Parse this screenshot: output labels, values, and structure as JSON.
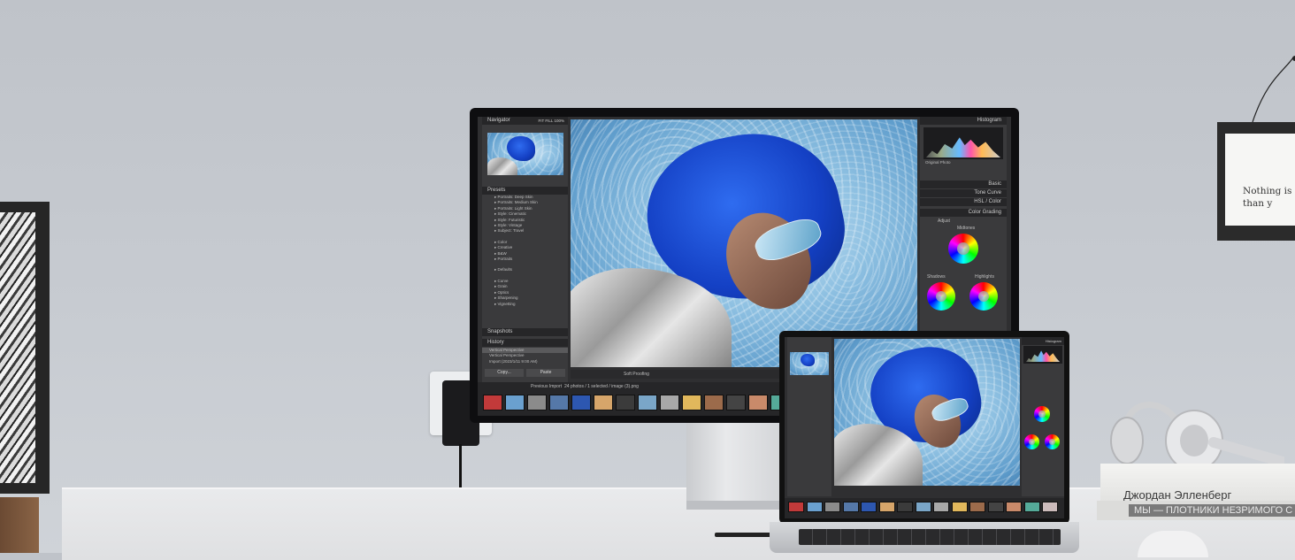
{
  "scene": {
    "description_free": true
  },
  "wall_frame": {
    "text": "Nothing is m\nthan y"
  },
  "book": {
    "author": "Джордан Элленберг",
    "title": "МЫ — ПЛОТНИКИ НЕЗРИМОГО С"
  },
  "monitor": {
    "left_panel": {
      "navigator": "Navigator",
      "navigator_zoom": "FIT  FILL  100%",
      "presets": "Presets",
      "preset_items": [
        "Portraits: Deep Skin",
        "Portraits: Medium Skin",
        "Portraits: Light Skin",
        "Style: Cinematic",
        "Style: Futuristic",
        "Style: Vintage",
        "Subject: Travel"
      ],
      "preset_items_2": [
        "Color",
        "Creative",
        "B&W",
        "Portraits"
      ],
      "preset_items_3": [
        "Defaults"
      ],
      "preset_items_4": [
        "Curve",
        "Grain",
        "Optics",
        "Sharpening",
        "Vignetting"
      ],
      "snapshots": "Snapshots",
      "history": "History",
      "history_items": [
        "Vertical Perspective",
        "Vertical Perspective",
        "Import (2023/1/11 9:00 AM)"
      ],
      "copy": "Copy...",
      "paste": "Paste"
    },
    "toolbar": {
      "soft_proofing": "Soft Proofing"
    },
    "filmstrip": {
      "source": "Previous Import",
      "info": "24 photos / 1 selected / image (3).png"
    },
    "right_panel": {
      "histogram": "Histogram",
      "original_photo": "Original Photo",
      "basic": "Basic",
      "tone_curve": "Tone Curve",
      "hsl": "HSL / Color",
      "color_grading": "Color Grading",
      "adjust": "Adjust",
      "midtones": "Midtones",
      "shadows": "Shadows",
      "highlights": "Highlights"
    }
  },
  "laptop": {
    "top_right": "Histogram"
  },
  "colors": {
    "wall": "#c3c7cd",
    "hood_blue": "#1f4fd8",
    "sky_blue": "#8fc1e2",
    "ui_dark": "#2f2f31"
  },
  "filmstrip_thumb_colors": [
    "#c23a3a",
    "#6aa0cf",
    "#8b8b8b",
    "#5578a8",
    "#2d57b0",
    "#d6a56a",
    "#3b3b3b",
    "#7aa6c8",
    "#a8a8a8",
    "#e1b85c",
    "#9c6b4b",
    "#444",
    "#c98a6a",
    "#5a9",
    "#cbb"
  ]
}
